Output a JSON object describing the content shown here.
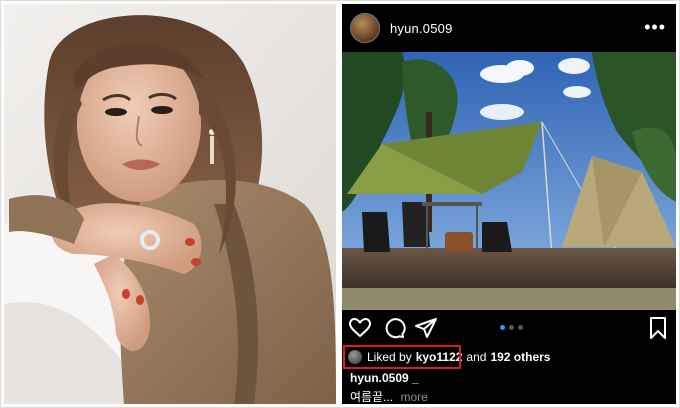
{
  "post": {
    "username": "hyun.0509",
    "more_icon": "•••",
    "likes": {
      "liked_by": "Liked by",
      "user": "kyo1122",
      "and_text": "and",
      "others": "192 others"
    },
    "caption_user": "hyun.0509 _",
    "caption_text": "여름끝...",
    "more_label": "more",
    "carousel": {
      "total": 3,
      "active": 1
    }
  },
  "colors": {
    "highlight_box": "#e01919",
    "active_dot": "#3897f0",
    "tent_green": "#8a9f45",
    "sky": "#3b74c4"
  },
  "icons": [
    "heart-icon",
    "comment-icon",
    "share-icon",
    "bookmark-icon",
    "more-options-icon"
  ]
}
